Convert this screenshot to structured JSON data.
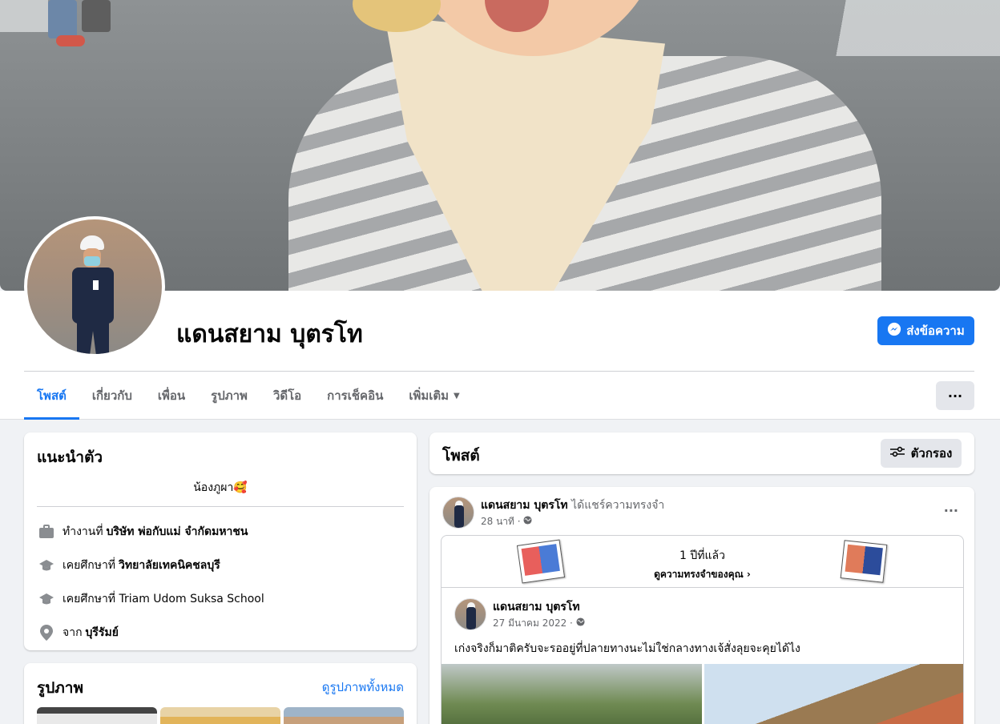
{
  "profile": {
    "name": "แดนสยาม บุตรโท",
    "message_button": "ส่งข้อความ"
  },
  "tabs": [
    {
      "label": "โพสต์",
      "active": true
    },
    {
      "label": "เกี่ยวกับ"
    },
    {
      "label": "เพื่อน"
    },
    {
      "label": "รูปภาพ"
    },
    {
      "label": "วิดีโอ"
    },
    {
      "label": "การเช็คอิน"
    },
    {
      "label": "เพิ่มเติม"
    }
  ],
  "more_button": "···",
  "intro": {
    "title": "แนะนำตัว",
    "bio": "น้องภูผา🥰",
    "rows": [
      {
        "icon": "briefcase-icon",
        "prefix": "ทำงานที่",
        "value": "บริษัท พ่อกับแม่ จำกัดมหาชน"
      },
      {
        "icon": "graduation-cap-icon",
        "prefix": "เคยศึกษาที่",
        "value": "วิทยาลัยเทคนิคชลบุรี"
      },
      {
        "icon": "graduation-cap-icon",
        "prefix": "เคยศึกษาที่ Triam Udom Suksa School",
        "value": ""
      },
      {
        "icon": "location-pin-icon",
        "prefix": "จาก",
        "value": "บุรีรัมย์"
      }
    ]
  },
  "photos": {
    "title": "รูปภาพ",
    "see_all": "ดูรูปภาพทั้งหมด"
  },
  "posts_header": {
    "title": "โพสต์",
    "filter_label": "ตัวกรอง"
  },
  "post": {
    "author": "แดนสยาม บุตรโท",
    "action": "ได้แชร์ความทรงจำ",
    "time": "28 นาที ·",
    "memory": {
      "years": "1 ปีที่แล้ว",
      "see_memories": "ดูความทรงจำของคุณ"
    },
    "inner": {
      "author": "แดนสยาม บุตรโท",
      "date": "27 มีนาคม 2022 ·",
      "text": "เก่งจริงก็มาติครับจะรออยู่ที่ปลายทางนะไม่ใช่กลางทางเจ้สั่งลุยจะคุยได้ไง"
    }
  },
  "colors": {
    "accent": "#1877f2",
    "background": "#f0f2f5"
  }
}
